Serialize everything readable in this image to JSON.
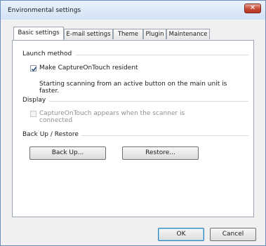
{
  "window": {
    "title": "Environmental settings"
  },
  "tabs": [
    {
      "label": "Basic settings"
    },
    {
      "label": "E-mail settings"
    },
    {
      "label": "Theme"
    },
    {
      "label": "Plugin"
    },
    {
      "label": "Maintenance"
    }
  ],
  "launch": {
    "heading": "Launch method",
    "checkbox_label": "Make CaptureOnTouch resident",
    "checked": true,
    "description": "Starting scanning from an active button on the main unit is faster."
  },
  "display": {
    "heading": "Display",
    "checkbox_label": "CaptureOnTouch appears when the scanner is connected",
    "checked": false,
    "enabled": false
  },
  "backup": {
    "heading": "Back Up / Restore",
    "backup_label": "Back Up...",
    "restore_label": "Restore..."
  },
  "footer": {
    "ok_label": "OK",
    "cancel_label": "Cancel"
  }
}
